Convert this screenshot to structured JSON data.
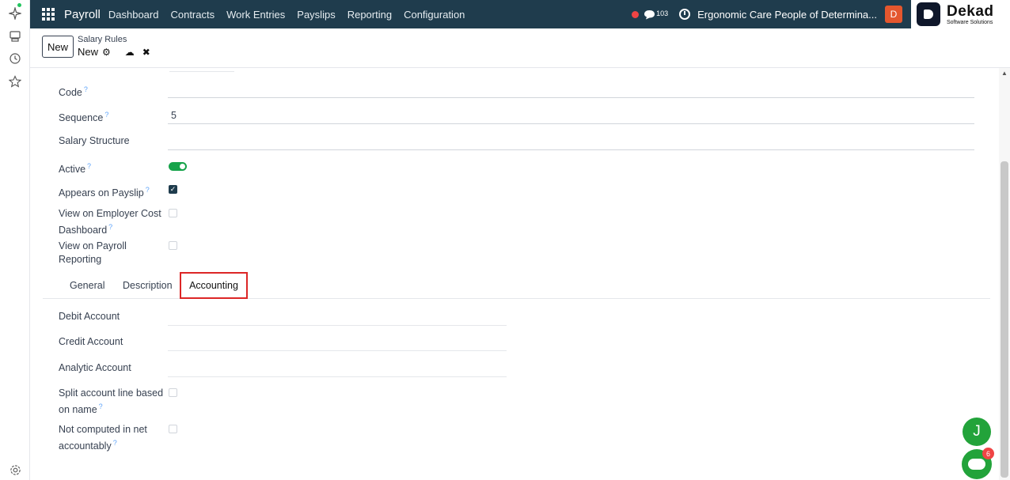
{
  "rail": {
    "icons": [
      "sparkle-icon",
      "monitor-icon",
      "clock-icon",
      "star-icon",
      "settings-icon"
    ]
  },
  "nav": {
    "app_name": "Payroll",
    "menu": [
      "Dashboard",
      "Contracts",
      "Work Entries",
      "Payslips",
      "Reporting",
      "Configuration"
    ],
    "message_count": "103",
    "company": "Ergonomic Care People of Determina...",
    "user_initial": "D",
    "logo_name": "Dekad",
    "logo_tagline": "Software Solutions"
  },
  "control": {
    "new_button": "New",
    "breadcrumb_parent": "Salary Rules",
    "record_name": "New",
    "gear_icon": "⚙",
    "save_icon": "☁",
    "discard_icon": "✖"
  },
  "form": {
    "code_label": "Code",
    "code_value": "",
    "sequence_label": "Sequence",
    "sequence_value": "5",
    "structure_label": "Salary Structure",
    "structure_value": "",
    "active_label": "Active",
    "active": true,
    "payslip_label": "Appears on Payslip",
    "payslip_checked": true,
    "employer_cost_label_1": "View on Employer Cost",
    "employer_cost_label_2": "Dashboard",
    "employer_cost_checked": false,
    "payroll_reporting_label_1": "View on Payroll",
    "payroll_reporting_label_2": "Reporting",
    "payroll_reporting_checked": false,
    "help_mark": "?"
  },
  "tabs": [
    {
      "label": "General",
      "active": false
    },
    {
      "label": "Description",
      "active": false
    },
    {
      "label": "Accounting",
      "active": true
    }
  ],
  "accounting": {
    "debit_label": "Debit Account",
    "debit_value": "",
    "credit_label": "Credit Account",
    "credit_value": "",
    "analytic_label": "Analytic Account",
    "analytic_value": "",
    "split_label_1": "Split account line based",
    "split_label_2": "on name",
    "split_checked": false,
    "not_computed_label_1": "Not computed in net",
    "not_computed_label_2": "accountably",
    "not_computed_checked": false
  },
  "floating": {
    "chat_initial": "J",
    "bot_badge": "6"
  },
  "colors": {
    "nav_bg": "#1f3c4d",
    "toggle_on": "#16a34a",
    "highlight": "#dc2626",
    "fab": "#22a33a"
  }
}
